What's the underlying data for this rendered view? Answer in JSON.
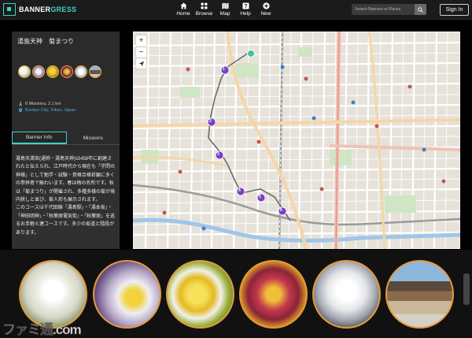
{
  "header": {
    "logo_text_primary": "BANNER",
    "logo_text_accent": "GRESS",
    "nav": [
      {
        "label": "Home",
        "icon": "home-icon"
      },
      {
        "label": "Browse",
        "icon": "grid-icon"
      },
      {
        "label": "Map",
        "icon": "map-icon"
      },
      {
        "label": "Help",
        "icon": "help-icon"
      },
      {
        "label": "New",
        "icon": "plus-circle-icon"
      }
    ],
    "search_placeholder": "Search Banners or Places",
    "signin_label": "Sign In"
  },
  "banner": {
    "title": "湯島天神　菊まつり",
    "missions_info": "6 Missions, 2.1 km",
    "place": "Bunkyo City, Tokyo, Japan",
    "tabs": [
      {
        "label": "Banner Info",
        "active": true
      },
      {
        "label": "Missions",
        "active": false
      }
    ],
    "description": [
      "湯島天満宮(通称・湯島天神)は458年に創建されたと伝えられ、江戸時代から現在も「学問の神様」として勉学・試験・資格合格祈願に多くの参拝者で賑わいます。春は梅の名所です。秋は「菊まつり」が開催され、多種多様の菊が境内狭しと並び、菊人形も展示されます。",
      "このコースは千代田線「湯島駅」・「湯本坂」・「神田明神」・「秋葉原電気街」・「秋葉原」を巡るお手軽６連コースです。多少の坂道と階段があります。"
    ]
  },
  "map": {
    "zoom_in": "+",
    "zoom_out": "−",
    "markers": [
      "1",
      "2",
      "3",
      "4",
      "5",
      "6"
    ]
  },
  "watermark": "ファミ通.com",
  "colors": {
    "accent": "#3fd1c4",
    "mission_border": "#e59a3c",
    "marker": "#7b3fc4",
    "link": "#4fa8e0"
  }
}
